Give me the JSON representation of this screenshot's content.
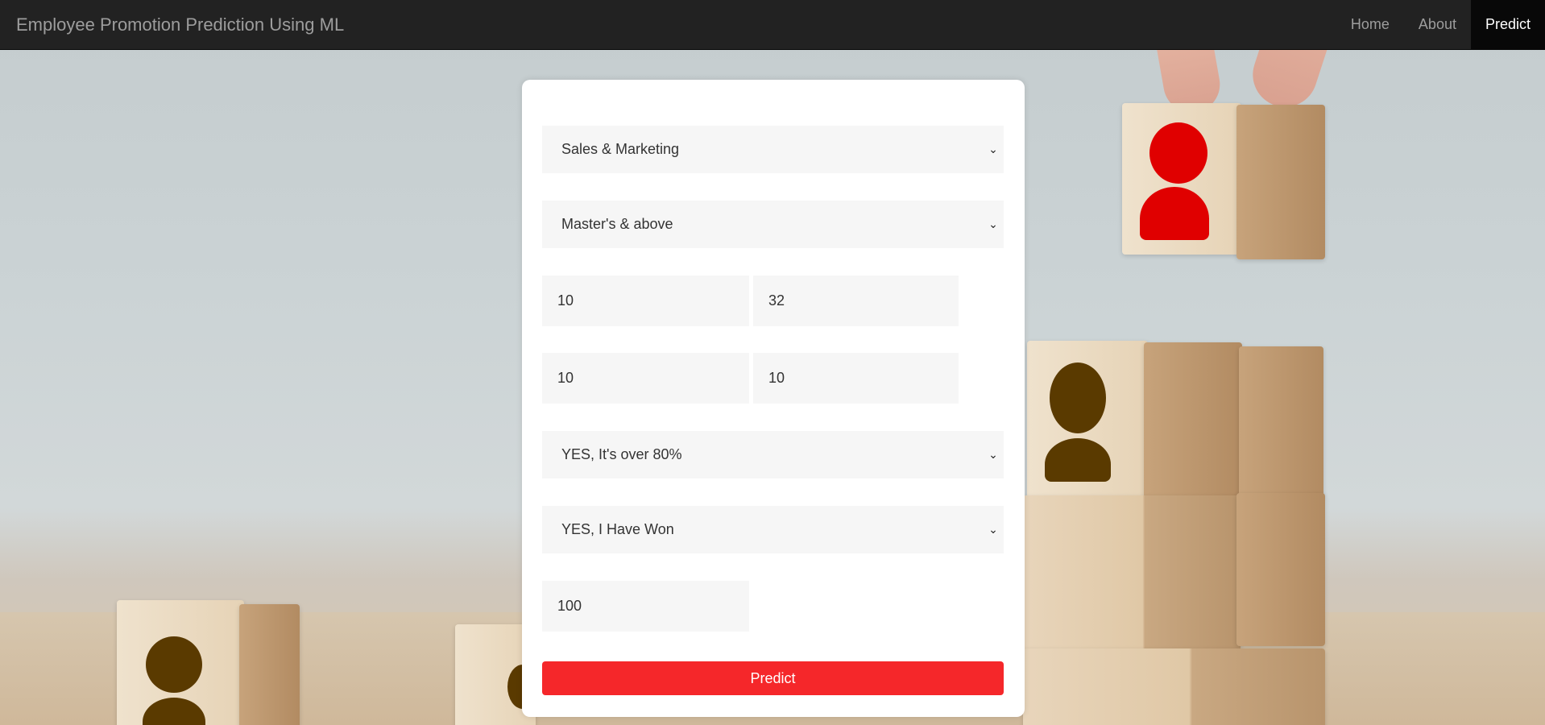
{
  "navbar": {
    "brand": "Employee Promotion Prediction Using ML",
    "items": [
      {
        "label": "Home",
        "active": false
      },
      {
        "label": "About",
        "active": false
      },
      {
        "label": "Predict",
        "active": true
      }
    ]
  },
  "form": {
    "department": "Sales & Marketing",
    "education": "Master's & above",
    "row1_left": "10",
    "row1_right": "32",
    "row2_left": "10",
    "row2_right": "10",
    "kpi": "YES, It's over 80%",
    "awards": "YES, I Have Won",
    "score": "100",
    "submit_label": "Predict"
  },
  "colors": {
    "navbar_bg": "#222222",
    "button_red": "#f5272a",
    "field_bg": "#f6f6f6",
    "person_red": "#e00000",
    "person_brown": "#5a3a00"
  },
  "icons": {
    "select_arrow": "chevron-down-icon"
  }
}
